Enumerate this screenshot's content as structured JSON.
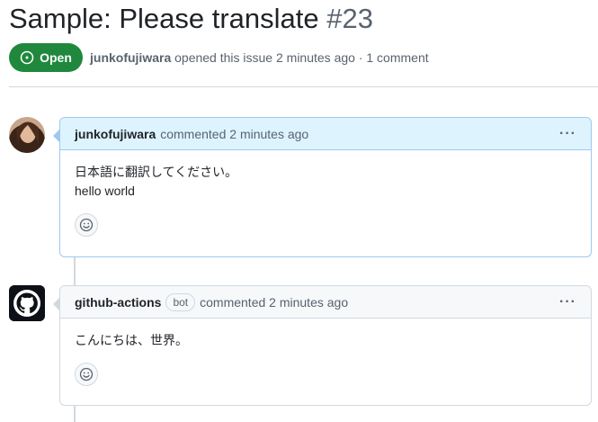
{
  "issue": {
    "title": "Sample: Please translate",
    "number": "#23",
    "state": "Open",
    "state_color": "#1f883d",
    "author": "junkofujiwara",
    "meta_rest": "opened this issue 2 minutes ago · 1 comment"
  },
  "comments": [
    {
      "author": "junkofujiwara",
      "action": "commented 2 minutes ago",
      "body_lines": [
        "日本語に翻訳してください。",
        "hello world"
      ],
      "menu": "···"
    },
    {
      "author": "github-actions",
      "bot_label": "bot",
      "action": "commented 2 minutes ago",
      "body_lines": [
        "こんにちは、世界。"
      ],
      "menu": "···"
    }
  ]
}
